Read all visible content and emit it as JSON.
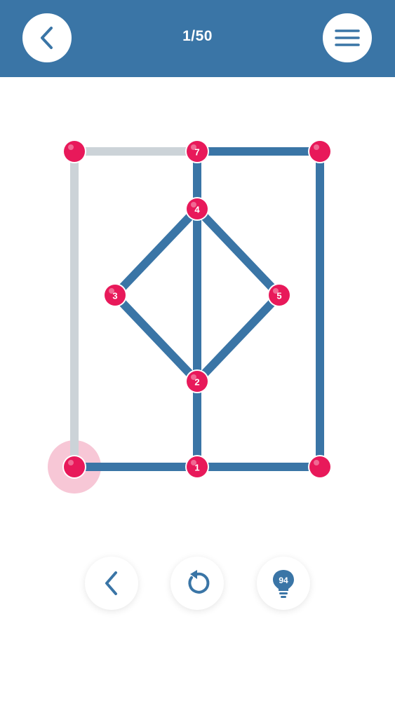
{
  "header": {
    "level_text": "1/50",
    "back_icon": "chevron-left-icon",
    "menu_icon": "hamburger-menu-icon"
  },
  "colors": {
    "header_bg": "#3a75a6",
    "edge_drawn": "#3a75a6",
    "edge_undrawn": "#ccd3d8",
    "node": "#e8195a",
    "node_highlight": "#f5b9cc"
  },
  "puzzle": {
    "nodes": [
      {
        "id": "n1",
        "label": "1"
      },
      {
        "id": "n2",
        "label": "2"
      },
      {
        "id": "n3",
        "label": "3"
      },
      {
        "id": "n4",
        "label": "4"
      },
      {
        "id": "n5",
        "label": "5"
      },
      {
        "id": "n7",
        "label": "7"
      },
      {
        "id": "tl",
        "label": ""
      },
      {
        "id": "tr",
        "label": ""
      },
      {
        "id": "bl",
        "label": "",
        "active": true
      },
      {
        "id": "br",
        "label": ""
      }
    ],
    "edges": [
      {
        "from": "tl",
        "to": "n7",
        "drawn": false
      },
      {
        "from": "tl",
        "to": "bl",
        "drawn": false
      },
      {
        "from": "n7",
        "to": "tr",
        "drawn": true
      },
      {
        "from": "tr",
        "to": "br",
        "drawn": true
      },
      {
        "from": "n7",
        "to": "n4",
        "drawn": true
      },
      {
        "from": "n4",
        "to": "n3",
        "drawn": true
      },
      {
        "from": "n4",
        "to": "n5",
        "drawn": true
      },
      {
        "from": "n4",
        "to": "n2",
        "drawn": true
      },
      {
        "from": "n3",
        "to": "n2",
        "drawn": true
      },
      {
        "from": "n5",
        "to": "n2",
        "drawn": true
      },
      {
        "from": "n2",
        "to": "n1",
        "drawn": true
      },
      {
        "from": "bl",
        "to": "n1",
        "drawn": true
      },
      {
        "from": "n1",
        "to": "br",
        "drawn": true
      }
    ]
  },
  "controls": {
    "undo_icon": "chevron-left-icon",
    "reset_icon": "restart-icon",
    "hint_icon": "lightbulb-icon",
    "hint_count": "94"
  }
}
